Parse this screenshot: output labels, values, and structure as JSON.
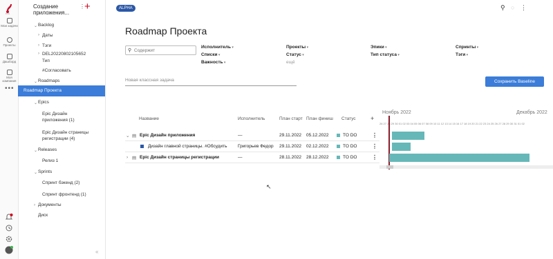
{
  "rail": {
    "items": [
      {
        "label": "Мои задачи"
      },
      {
        "label": "Проекты"
      },
      {
        "label": "Дашборд"
      },
      {
        "label": "Моя компания"
      }
    ]
  },
  "sidebar": {
    "title": "Создание приложения...",
    "tree": [
      {
        "label": "Backlog"
      },
      {
        "label": "Даты"
      },
      {
        "label": "Тэги"
      },
      {
        "label": "DEL20220802105652"
      },
      {
        "label": "Тип"
      },
      {
        "label": "#Согласовать"
      },
      {
        "label": "Roadmaps"
      },
      {
        "label": "Roadmap Проекта"
      },
      {
        "label": "Epics"
      },
      {
        "label": "Epic Дизайн"
      },
      {
        "label": "приложения (1)"
      },
      {
        "label": "Epic Дизайн страницы"
      },
      {
        "label": "регистрации (4)"
      },
      {
        "label": "Releases"
      },
      {
        "label": "Релиз 1"
      },
      {
        "label": "Sprints"
      },
      {
        "label": "Спринт бэкенд (2)"
      },
      {
        "label": "Спринт фронтенд (1)"
      },
      {
        "label": "Документы"
      },
      {
        "label": "Диск"
      }
    ]
  },
  "header": {
    "badge": "ALPHA",
    "title": "Roadmap Проекта"
  },
  "search": {
    "placeholder": "Содержит"
  },
  "filters": {
    "f1": "Исполнитель",
    "f2": "Списки",
    "f3": "Важность",
    "f4": "Проекты",
    "f5": "Статус",
    "f6": "Эпики",
    "f7": "Тип статуса",
    "f8": "Спринты",
    "f9": "Тэги",
    "more": "ещё"
  },
  "new_task_placeholder": "Новая классная задача",
  "baseline_button": "Сохранить Baseline",
  "table": {
    "headers": {
      "name": "Название",
      "assignee": "Исполнитель",
      "start": "План старт",
      "finish": "План финиш",
      "status": "Статус"
    },
    "rows": [
      {
        "name": "Epic Дизайн приложения",
        "assignee": "—",
        "start": "29.11.2022",
        "finish": "05.12.2022",
        "status": "TO DO"
      },
      {
        "name": "Дизайн главной страницы. #Обсудить",
        "assignee": "Григорьев Федор",
        "start": "29.11.2022",
        "finish": "02.12.2022",
        "status": "TO DO"
      },
      {
        "name": "Epic Дизайн страницы регистрации",
        "assignee": "—",
        "start": "28.11.2022",
        "finish": "28.12.2022",
        "status": "TO DO"
      }
    ]
  },
  "gantt": {
    "month1": "Ноябрь 2022",
    "month2": "Декабрь 2022",
    "days": "26 27 28 29 30 01 02 03 04 05 06 07 08 09 10 11 12 13 14 15 16 17 18 19 20 21 22 23 24 25 26 27 28 29 30 31 01 02"
  },
  "colors": {
    "accent": "#3b7dd8",
    "badge": "#2b57a6",
    "bar": "#66b8b8",
    "status": "#66b8b8",
    "add": "#d0021b"
  }
}
